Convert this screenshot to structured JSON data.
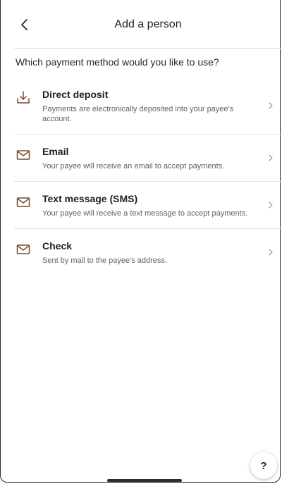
{
  "header": {
    "title": "Add a person",
    "back_icon": "chevron-left-icon"
  },
  "question": "Which payment method would you like to use?",
  "methods": [
    {
      "title": "Direct deposit",
      "description": "Payments are electronically deposited into your payee's account.",
      "icon": "download-tray-icon"
    },
    {
      "title": "Email",
      "description": "Your payee will receive an email to accept payments.",
      "icon": "envelope-icon"
    },
    {
      "title": "Text message (SMS)",
      "description": "Your payee will receive a text message to accept payments.",
      "icon": "envelope-icon"
    },
    {
      "title": "Check",
      "description": "Sent by mail to the payee's address.",
      "icon": "envelope-icon"
    }
  ],
  "help_button": {
    "label": "?"
  },
  "colors": {
    "icon_accent": "#7a4a2a",
    "divider": "#e2e2e2",
    "text_primary": "#1f1f1f",
    "text_secondary": "#5f5f5f"
  }
}
